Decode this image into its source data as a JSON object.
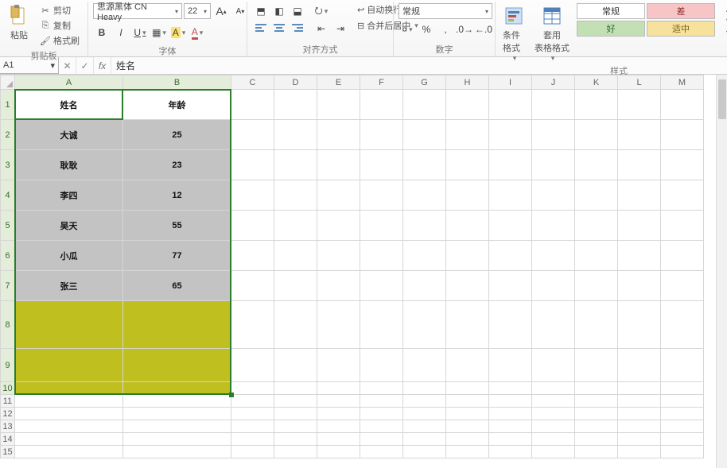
{
  "ribbon": {
    "clipboard": {
      "label": "剪贴板",
      "paste": "粘贴",
      "cut": "剪切",
      "copy": "复制",
      "format_painter": "格式刷"
    },
    "font": {
      "label": "字体",
      "family": "思源黑体 CN Heavy",
      "size": "22",
      "grow": "A",
      "shrink": "A",
      "bold": "B",
      "italic": "I",
      "underline": "U",
      "highlight": "A",
      "fontcolor": "A"
    },
    "alignment": {
      "label": "对齐方式",
      "wrap": "自动换行",
      "merge": "合并后居中"
    },
    "number": {
      "label": "数字",
      "format": "常规",
      "currency": "%",
      "comma": ","
    },
    "styles": {
      "label": "样式",
      "conditional": "条件格式",
      "table": "套用\n表格格式",
      "normal": "常规",
      "bad": "差",
      "good": "好",
      "neutral": "适中"
    }
  },
  "name_box": "A1",
  "formula_value": "姓名",
  "columns": [
    "A",
    "B",
    "C",
    "D",
    "E",
    "F",
    "G",
    "H",
    "I",
    "J",
    "K",
    "L",
    "M"
  ],
  "row_count": 15,
  "table": {
    "headers": [
      "姓名",
      "年龄"
    ],
    "rows": [
      {
        "name": "大诚",
        "age": "25"
      },
      {
        "name": "耿耿",
        "age": "23"
      },
      {
        "name": "李四",
        "age": "12"
      },
      {
        "name": "吴天",
        "age": "55"
      },
      {
        "name": "小瓜",
        "age": "77"
      },
      {
        "name": "张三",
        "age": "65"
      }
    ]
  },
  "selection": {
    "from": "A1",
    "to": "B10",
    "active": "A1"
  }
}
